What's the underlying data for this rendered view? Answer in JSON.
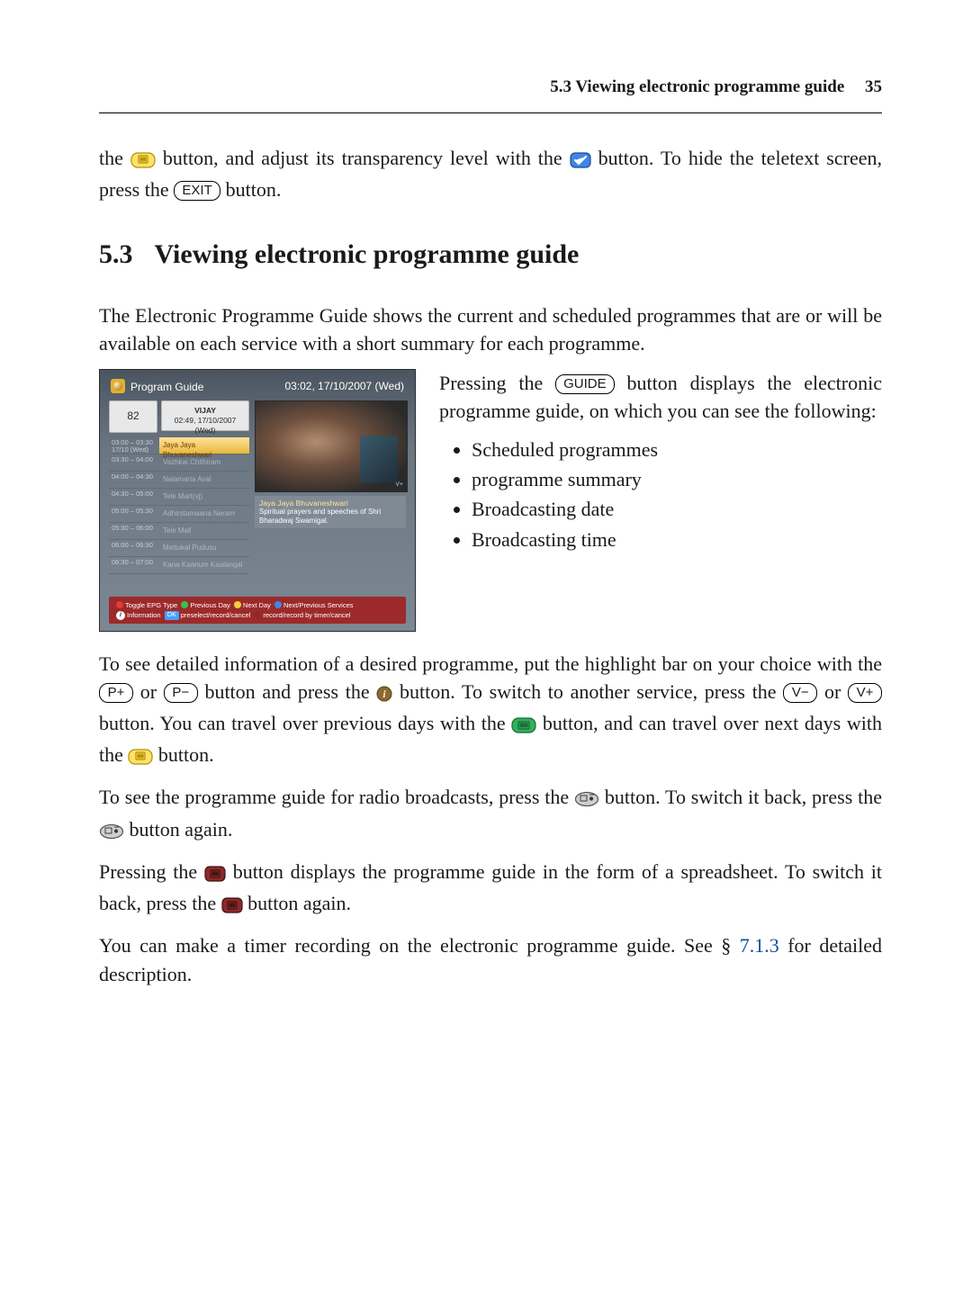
{
  "header": {
    "section_label": "5.3 Viewing electronic programme guide",
    "page_number": "35"
  },
  "continuation_para": {
    "t1": "the ",
    "t2": " button, and adjust its transparency level with the ",
    "t3": " button. To hide the teletext screen, press the ",
    "t4": " button.",
    "exit_key": "EXIT"
  },
  "section": {
    "number": "5.3",
    "title": "Viewing electronic programme guide"
  },
  "intro_para": "The Electronic Programme Guide shows the current and scheduled programmes that are or will be available on each service with a short summary for each programme.",
  "guide_box": {
    "pre": "Pressing the ",
    "key": "GUIDE",
    "post": " button displays the electronic programme guide, on which you can see the following:",
    "bullets": [
      "Scheduled programmes",
      "programme summary",
      "Broadcasting date",
      "Broadcasting time"
    ]
  },
  "epg": {
    "title": "Program Guide",
    "datetime": "03:02, 17/10/2007 (Wed)",
    "channel_number": "82",
    "channel_name": "VIJAY",
    "channel_time": "02:49, 17/10/2007 (Wed)",
    "preview_corner": "V+",
    "rows": [
      {
        "time": "03:00 – 03:30\n17/10 (Wed)",
        "title": "Jaya Jaya Bhuvaneshwari",
        "selected": true
      },
      {
        "time": "03:30 – 04:00",
        "title": "Vazhkai Chithiram",
        "selected": false
      },
      {
        "time": "04:00 – 04:30",
        "title": "Nalamaria Aval",
        "selected": false
      },
      {
        "time": "04:30 – 05:00",
        "title": "Tele Mart(vj)",
        "selected": false
      },
      {
        "time": "05:00 – 05:30",
        "title": "Adhirstamaana Neram",
        "selected": false
      },
      {
        "time": "05:30 – 06:00",
        "title": "Tele Mall",
        "selected": false
      },
      {
        "time": "06:00 – 06:30",
        "title": "Mettukal Pudusu",
        "selected": false
      },
      {
        "time": "06:30 – 07:00",
        "title": "Kana Kaanum Kaalangal",
        "selected": false
      }
    ],
    "detail_title": "Jaya Jaya Bhuvaneshwari",
    "detail_body": "Spiritual prayers and speeches of Shri Bharadwaj Swamigal.",
    "footer": {
      "toggle": "Toggle EPG Type",
      "prev_day": "Previous Day",
      "next_day": "Next Day",
      "next_prev_services": "Next/Previous Services",
      "info": "Information",
      "ok": "OK",
      "preselect": "preselect/record/cancel",
      "record_timer": "record/record by timer/cancel"
    }
  },
  "p_detail": {
    "a": "To see detailed information of a desired programme, put the highlight bar on your choice with the ",
    "p_plus": "P+",
    "b": " or ",
    "p_minus": "P−",
    "c": " button and press the ",
    "d": " button. To switch to another service, press the ",
    "v_minus": "V−",
    "e": " or ",
    "v_plus": "V+",
    "f": " button. You can travel over previous days with the ",
    "g": " button, and can travel over next days with the ",
    "h": " button."
  },
  "p_radio": {
    "a": "To see the programme guide for radio broadcasts, press the ",
    "b": " button. To switch it back, press the ",
    "c": " button again."
  },
  "p_spread": {
    "a": "Pressing the ",
    "b": " button displays the programme guide in the form of a spreadsheet. To switch it back, press the ",
    "c": " button again."
  },
  "p_timer": {
    "a": "You can make a timer recording on the electronic programme guide. See § ",
    "xref": "7.1.3",
    "b": " for detailed description."
  }
}
